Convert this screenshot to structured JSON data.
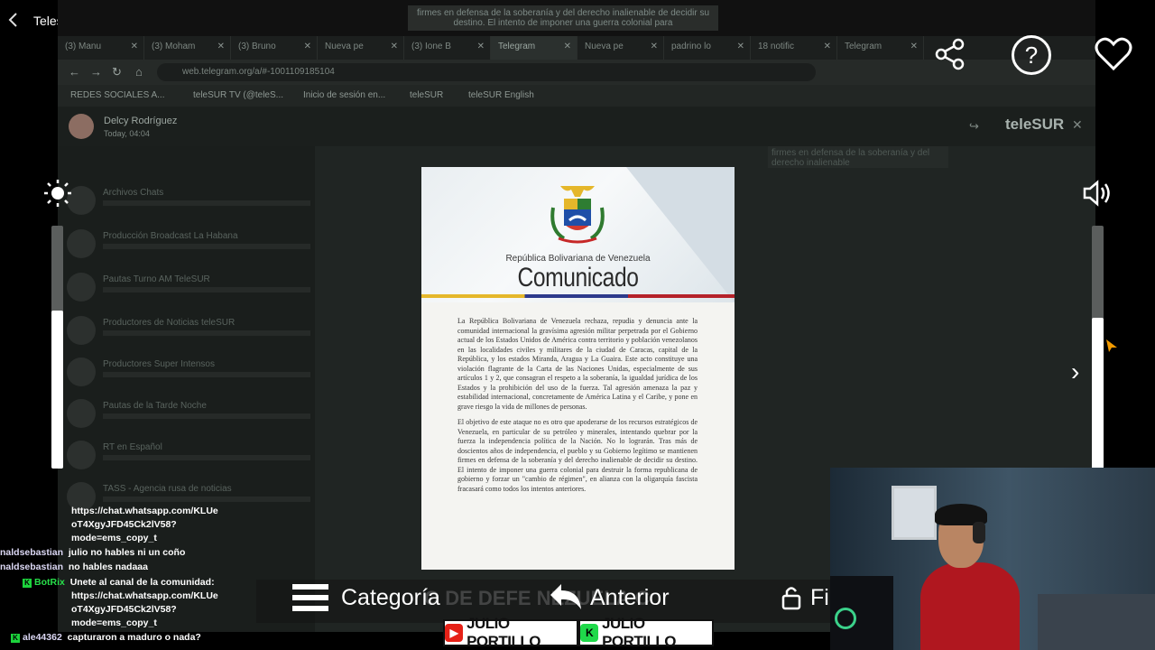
{
  "app_bar": {
    "back_label": "<",
    "title": "Telesur HD"
  },
  "browser": {
    "bleed_note": "firmes en defensa de la soberanía y del derecho inalienable de decidir su destino. El intento de imponer una guerra colonial para",
    "tabs": [
      {
        "label": "(3) Manu"
      },
      {
        "label": "(3) Moham"
      },
      {
        "label": "(3) Bruno"
      },
      {
        "label": "Nueva pe"
      },
      {
        "label": "(3) Ione B"
      },
      {
        "label": "Telegram"
      },
      {
        "label": "Nueva pe"
      },
      {
        "label": "padrino lo"
      },
      {
        "label": "18 notific"
      },
      {
        "label": "Telegram"
      }
    ],
    "url": "web.telegram.org/a/#-1001109185104",
    "bookmarks": [
      {
        "label": "REDES SOCIALES A..."
      },
      {
        "label": "teleSUR TV (@teleS..."
      },
      {
        "label": "Inicio de sesión en..."
      },
      {
        "label": "teleSUR"
      },
      {
        "label": "teleSUR English"
      }
    ]
  },
  "telegram": {
    "sender": "Delcy Rodríguez",
    "time": "Today, 04:04",
    "logo": "teleSUR",
    "chats": [
      {
        "name": "Archivos Chats"
      },
      {
        "name": "Producción Broadcast La Habana"
      },
      {
        "name": "Pautas Turno AM TeleSUR"
      },
      {
        "name": "Productores de Noticias teleSUR"
      },
      {
        "name": "Productores Super Intensos"
      },
      {
        "name": "Pautas de la Tarde Noche"
      },
      {
        "name": "RT en Español"
      },
      {
        "name": "TASS - Agencia rusa de noticias"
      }
    ],
    "ghost_message": "firmes en defensa de la soberanía y del derecho inalienable"
  },
  "document": {
    "republic": "República Bolivariana de Venezuela",
    "title": "Comunicado",
    "paragraph_1": "La República Bolivariana de Venezuela rechaza, repudia y denuncia ante la comunidad internacional la gravísima agresión militar perpetrada por el Gobierno actual de los Estados Unidos de América contra territorio y población venezolanos en las localidades civiles y militares de la ciudad de Caracas, capital de la República, y los estados Miranda, Aragua y La Guaira. Este acto constituye una violación flagrante de la Carta de las Naciones Unidas, especialmente de sus artículos 1 y 2, que consagran el respeto a la soberanía, la igualdad jurídica de los Estados y la prohibición del uso de la fuerza. Tal agresión amenaza la paz y estabilidad internacional, concretamente de América Latina y el Caribe, y pone en grave riesgo la vida de millones de personas.",
    "paragraph_2": "El objetivo de este ataque no es otro que apoderarse de los recursos estratégicos de Venezuela, en particular de su petróleo y minerales, intentando quebrar por la fuerza la independencia política de la Nación. No lo lograrán. Tras más de doscientos años de independencia, el pueblo y su Gobierno legítimo se mantienen firmes en defensa de la soberanía y del derecho inalienable de decidir su destino. El intento de imponer una guerra colonial para destruir la forma republicana de gobierno y forzar un \"cambio de régimen\", en alianza con la oligarquía fascista fracasará como todos los intentos anteriores."
  },
  "viewer": {
    "brightness_level": 0.65,
    "volume_level": 0.62,
    "icons": {
      "share": "share-icon",
      "help": "help-icon",
      "heart": "heart-icon",
      "brightness": "brightness-icon",
      "volume": "volume-icon",
      "next": "chevron-right-icon"
    },
    "help_glyph": "?",
    "next_glyph": "›"
  },
  "chat_overlay": {
    "lines": [
      {
        "user": "",
        "text": "https://chat.whatsapp.com/KLUe"
      },
      {
        "user": "",
        "text": "oT4XgyJFD45Ck2lV58?"
      },
      {
        "user": "",
        "text": "mode=ems_copy_t"
      },
      {
        "user": "naldsebastian",
        "text": "julio no hables ni un coño"
      },
      {
        "user": "naldsebastian",
        "text": "no hables nadaaa"
      },
      {
        "user": "BotRix",
        "text": "Unete al canal de la comunidad:"
      },
      {
        "user": "",
        "text": "https://chat.whatsapp.com/KLUe"
      },
      {
        "user": "",
        "text": "oT4XgyJFD45Ck2lV58?"
      },
      {
        "user": "",
        "text": "mode=ems_copy_t"
      },
      {
        "user": "ale44362",
        "text": "capturaron a maduro o nada?"
      }
    ]
  },
  "bottom_bar": {
    "ghost_text": "O DE DEFE        NEZUELA C",
    "category_label": "Categoría",
    "previous_label": "Anterior",
    "fi_label": "Fi"
  },
  "branding": {
    "youtube_name": "JULIO PORTILLO",
    "kick_name": "JULIO PORTILLO",
    "kick_glyph": "K",
    "yt_glyph": "▶"
  },
  "colors": {
    "accent_green": "#1fd94a",
    "youtube_red": "#e62117",
    "flag_yellow": "#e5b72a",
    "flag_blue": "#2d3a8c",
    "flag_red": "#b52129"
  }
}
